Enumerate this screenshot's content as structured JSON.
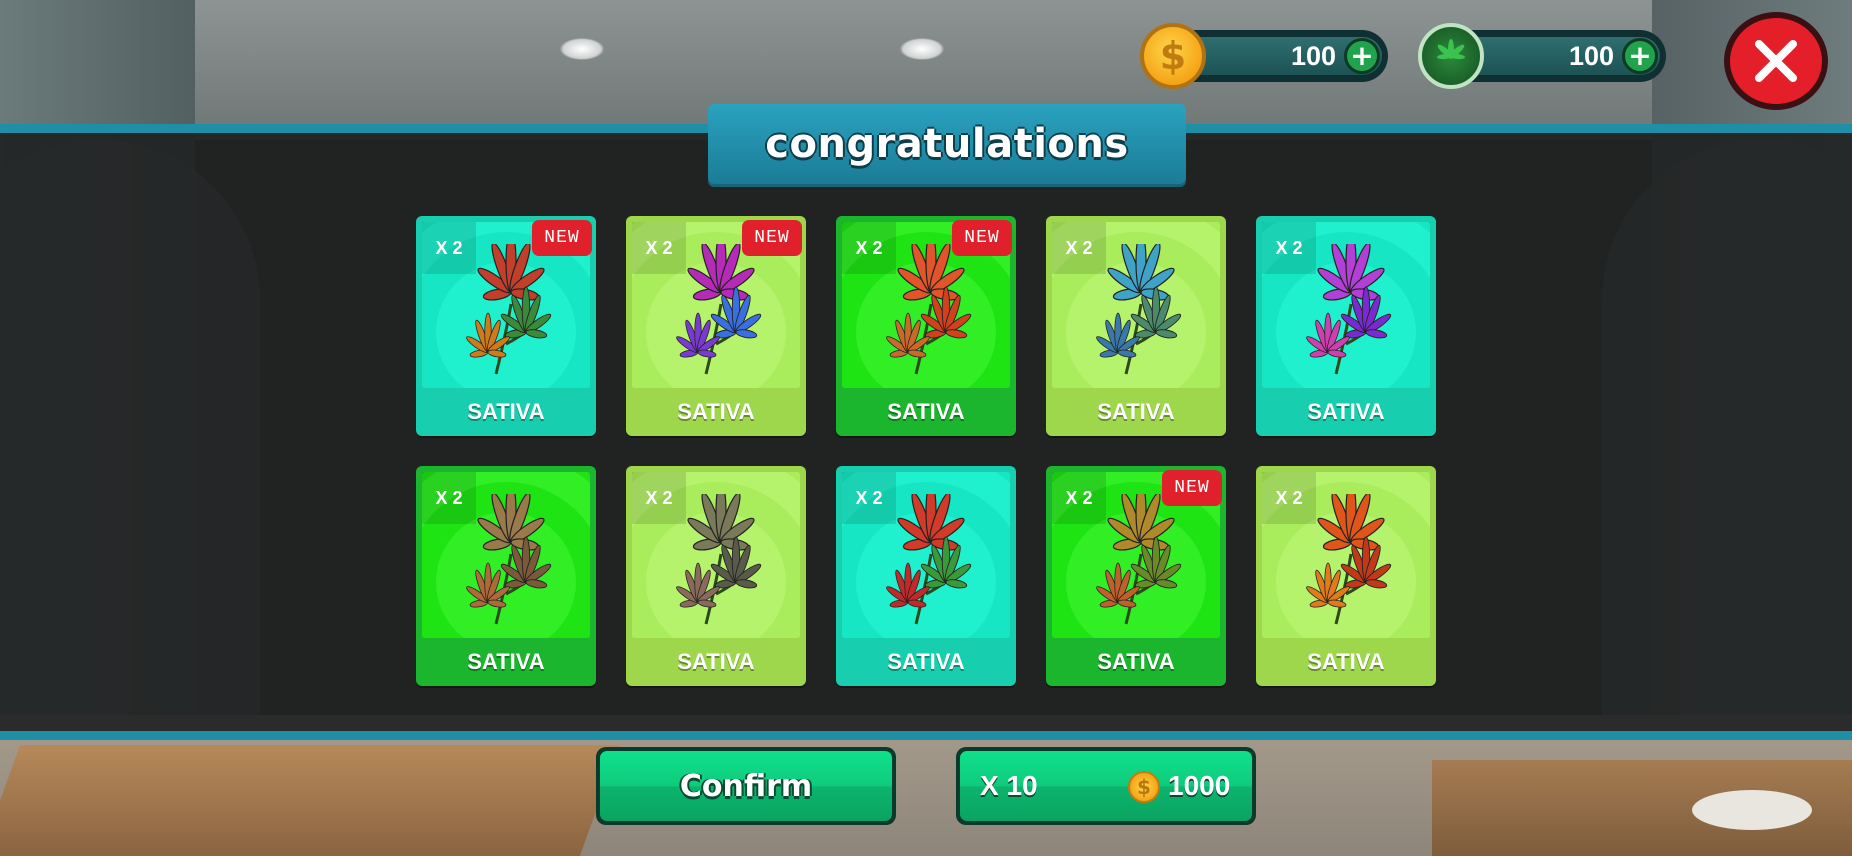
{
  "title": "congratulations",
  "currency": {
    "coins": {
      "amount": "100",
      "icon": "dollar-coin-icon",
      "symbol": "$"
    },
    "leaves": {
      "amount": "100",
      "icon": "cannabis-leaf-icon"
    },
    "plus_symbol": "+"
  },
  "close_symbol": "✕",
  "cards": [
    {
      "qty": "X 2",
      "name": "SATIVA",
      "new": "NEW",
      "theme": "teal",
      "leaf_colors": [
        "#c2402b",
        "#3b8a3a",
        "#d07a1c"
      ]
    },
    {
      "qty": "X 2",
      "name": "SATIVA",
      "new": "NEW",
      "theme": "lime",
      "leaf_colors": [
        "#b52bb8",
        "#3a6fe0",
        "#7a3ad0"
      ]
    },
    {
      "qty": "X 2",
      "name": "SATIVA",
      "new": "NEW",
      "theme": "green",
      "leaf_colors": [
        "#e2542a",
        "#d0411c",
        "#c96a2a"
      ]
    },
    {
      "qty": "X 2",
      "name": "SATIVA",
      "new": "",
      "theme": "lime",
      "leaf_colors": [
        "#3fa3c8",
        "#4b8a6a",
        "#3a78a8"
      ]
    },
    {
      "qty": "X 2",
      "name": "SATIVA",
      "new": "",
      "theme": "teal",
      "leaf_colors": [
        "#b23fd6",
        "#7a2bd0",
        "#d03fb0"
      ]
    },
    {
      "qty": "X 2",
      "name": "SATIVA",
      "new": "",
      "theme": "green",
      "leaf_colors": [
        "#9a7a4a",
        "#7a5a3a",
        "#b06a3a"
      ]
    },
    {
      "qty": "X 2",
      "name": "SATIVA",
      "new": "",
      "theme": "lime",
      "leaf_colors": [
        "#7a7a5a",
        "#5a5a4a",
        "#8a6a5a"
      ]
    },
    {
      "qty": "X 2",
      "name": "SATIVA",
      "new": "",
      "theme": "teal",
      "leaf_colors": [
        "#d23a2a",
        "#3a9a3a",
        "#c02a2a"
      ]
    },
    {
      "qty": "X 2",
      "name": "SATIVA",
      "new": "NEW",
      "theme": "green",
      "leaf_colors": [
        "#b08a2a",
        "#6a8a2a",
        "#c0602a"
      ]
    },
    {
      "qty": "X 2",
      "name": "SATIVA",
      "new": "",
      "theme": "lime",
      "leaf_colors": [
        "#e0561a",
        "#c03a1a",
        "#e07a1a"
      ]
    }
  ],
  "buttons": {
    "confirm": "Confirm",
    "multi": {
      "label": "X 10",
      "cost": "1000",
      "icon": "dollar-coin-icon"
    }
  }
}
